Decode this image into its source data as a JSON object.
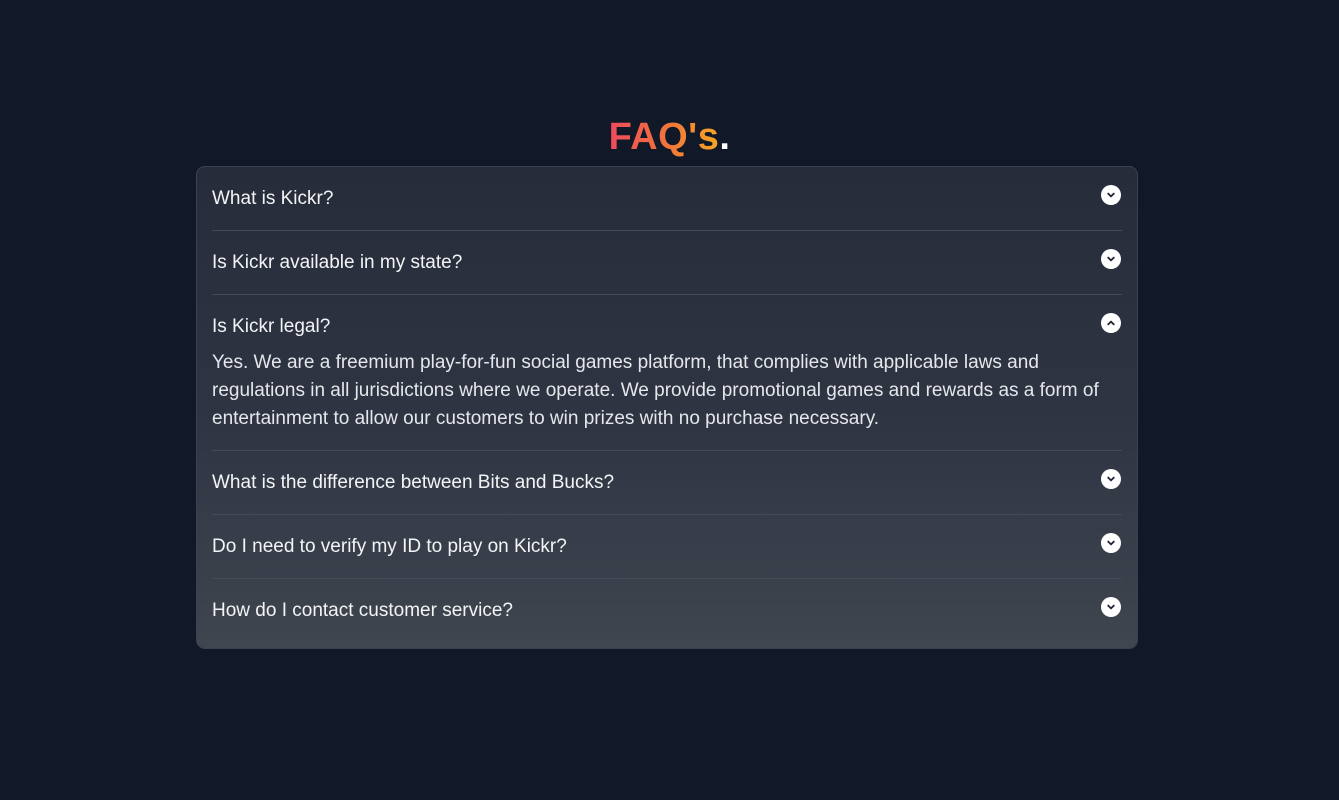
{
  "heading": {
    "word": "FAQ's",
    "dot": "."
  },
  "colors": {
    "background": "#111827",
    "gradient_start": "#ef4a5c",
    "gradient_end": "#f5a623"
  },
  "faqs": [
    {
      "question": "What is Kickr?",
      "expanded": false,
      "icon": "chevron-down-icon"
    },
    {
      "question": "Is Kickr available in my state?",
      "expanded": false,
      "icon": "chevron-down-icon"
    },
    {
      "question": "Is Kickr legal?",
      "expanded": true,
      "icon": "chevron-up-icon",
      "answer": "Yes. We are a freemium play-for-fun social games platform, that complies with applicable laws and regulations in all jurisdictions where we operate. We provide promotional games and rewards as a form of entertainment to allow our customers to win prizes with no purchase necessary."
    },
    {
      "question": "What is the difference between Bits and Bucks?",
      "expanded": false,
      "icon": "chevron-down-icon"
    },
    {
      "question": "Do I need to verify my ID to play on Kickr?",
      "expanded": false,
      "icon": "chevron-down-icon"
    },
    {
      "question": "How do I contact customer service?",
      "expanded": false,
      "icon": "chevron-down-icon"
    }
  ]
}
